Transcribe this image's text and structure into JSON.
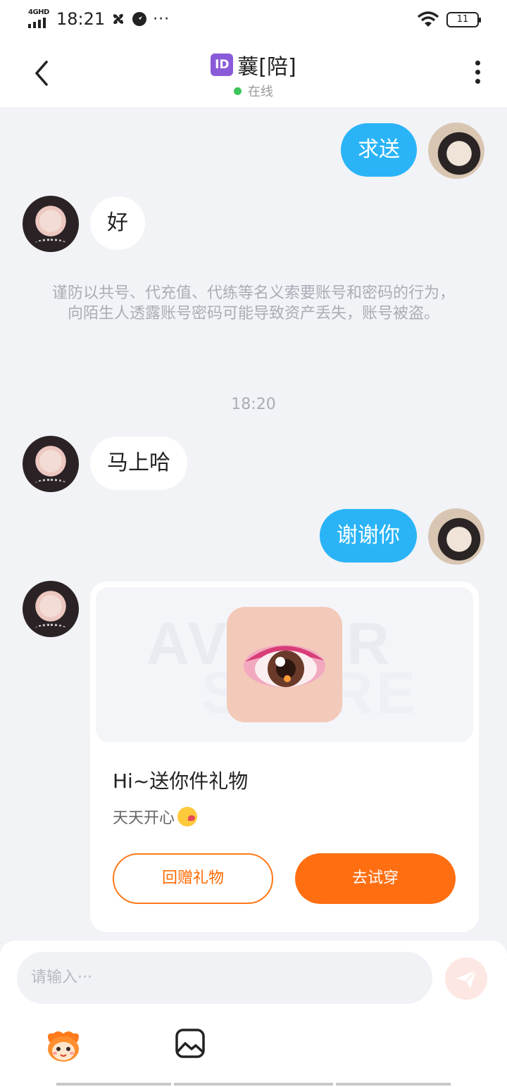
{
  "status_bar": {
    "network": "4GHD",
    "time": "18:21",
    "dots": "···",
    "battery": "11"
  },
  "header": {
    "id_badge": "ID",
    "title": "蘘[陪]",
    "status": "在线"
  },
  "messages": [
    {
      "side": "me",
      "text": "求送"
    },
    {
      "side": "other",
      "text": "好"
    },
    {
      "side": "other",
      "text": "马上哈"
    },
    {
      "side": "me",
      "text": "谢谢你"
    }
  ],
  "warning": "谨防以共号、代充值、代练等名义索要账号和密码的行为，向陌生人透露账号密码可能导致资产丢失，账号被盗。",
  "timestamp": "18:20",
  "gift_card": {
    "watermark_line1": "AVATAR",
    "watermark_line2": "STORE",
    "title": "Hi~送你件礼物",
    "subtitle": "天天开心",
    "button_return": "回赠礼物",
    "button_try": "去试穿"
  },
  "input": {
    "placeholder": "请输入···"
  },
  "colors": {
    "accent_blue": "#2ab4f7",
    "accent_orange": "#ff6f12",
    "online_green": "#3bc45a",
    "id_purple": "#8a5bd8"
  },
  "icons": [
    "signal-icon",
    "fan-icon",
    "compass-icon",
    "wifi-icon",
    "battery-icon",
    "back-arrow-icon",
    "more-vertical-icon",
    "kiss-emoji-icon",
    "send-icon",
    "emoji-mascot-icon",
    "image-icon"
  ]
}
